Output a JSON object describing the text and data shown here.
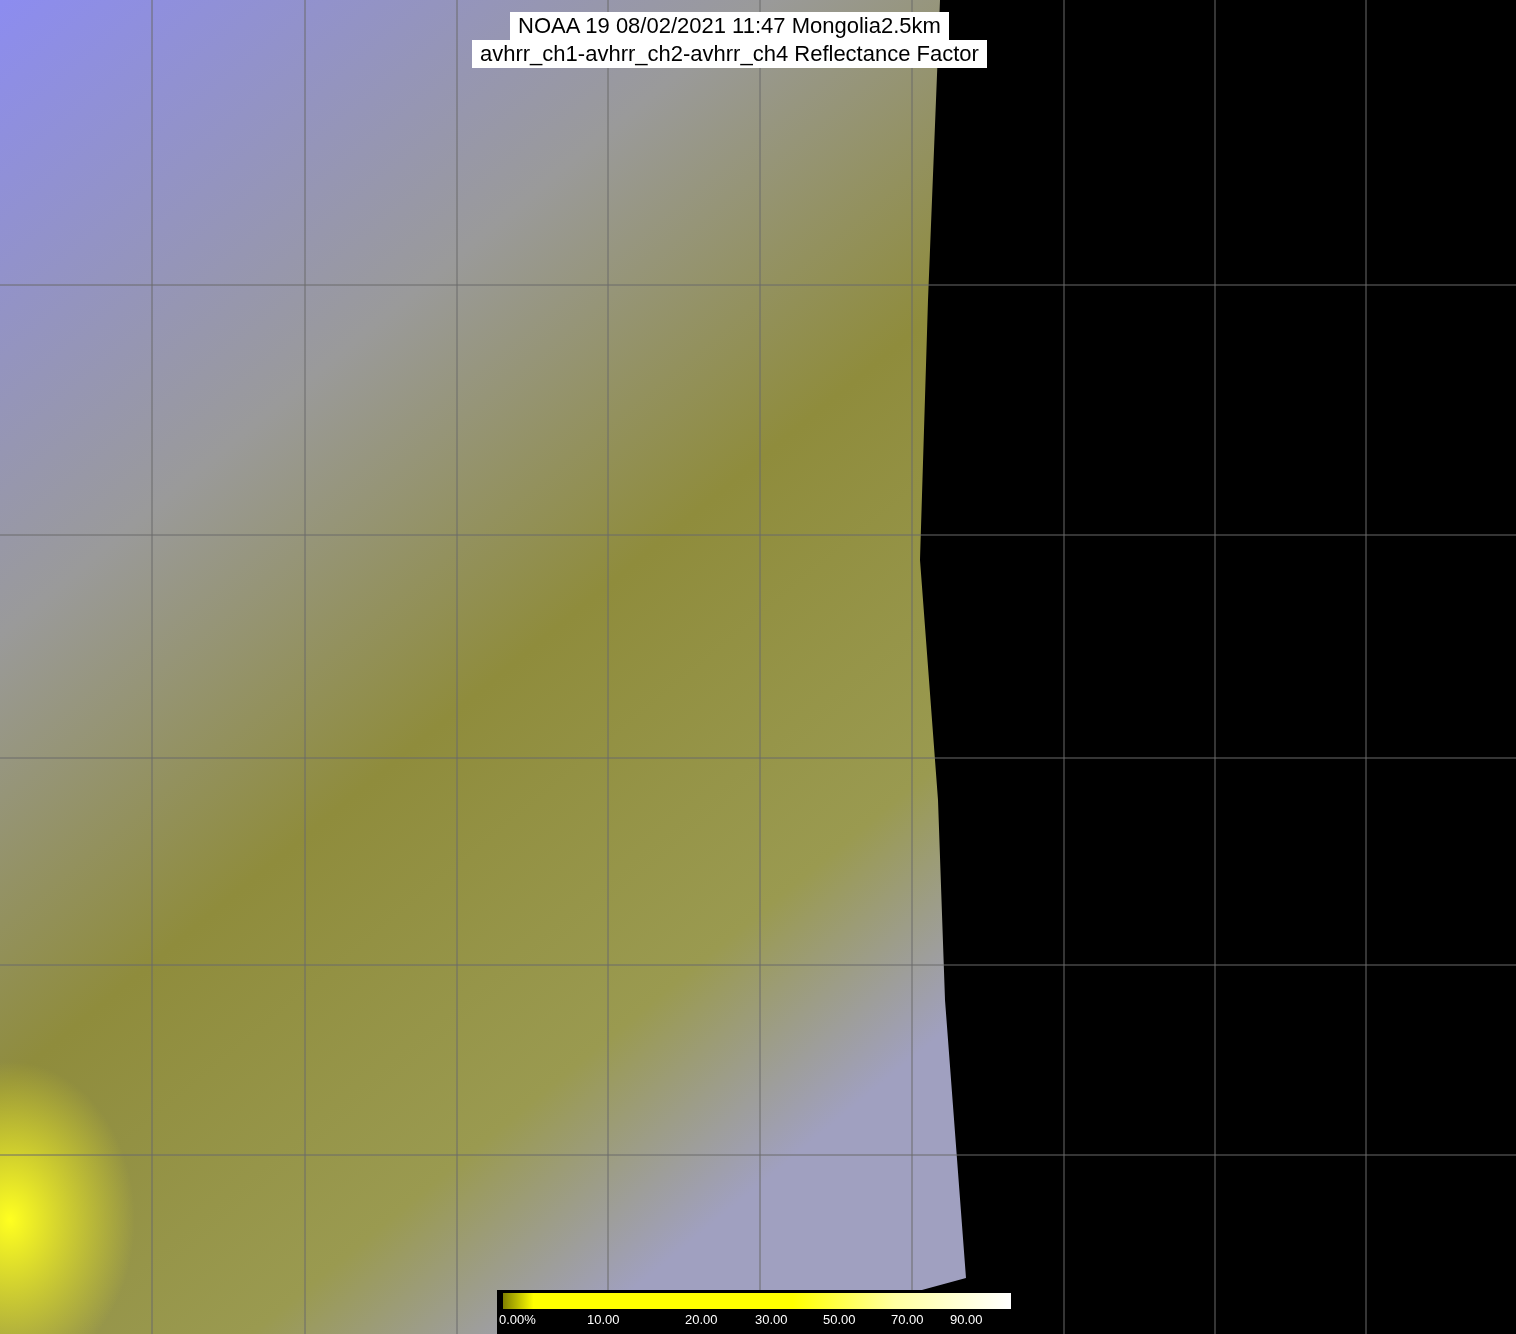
{
  "title": {
    "lines": [
      "NOAA 19 08/02/2021 11:47 Mongolia2.5km",
      "avhrr_ch1-avhrr_ch2-avhrr_ch4 Reflectance Factor"
    ]
  },
  "colorbar": {
    "labels": [
      "0.00%",
      "10.00",
      "20.00",
      "30.00",
      "50.00",
      "70.00",
      "90.00"
    ]
  }
}
